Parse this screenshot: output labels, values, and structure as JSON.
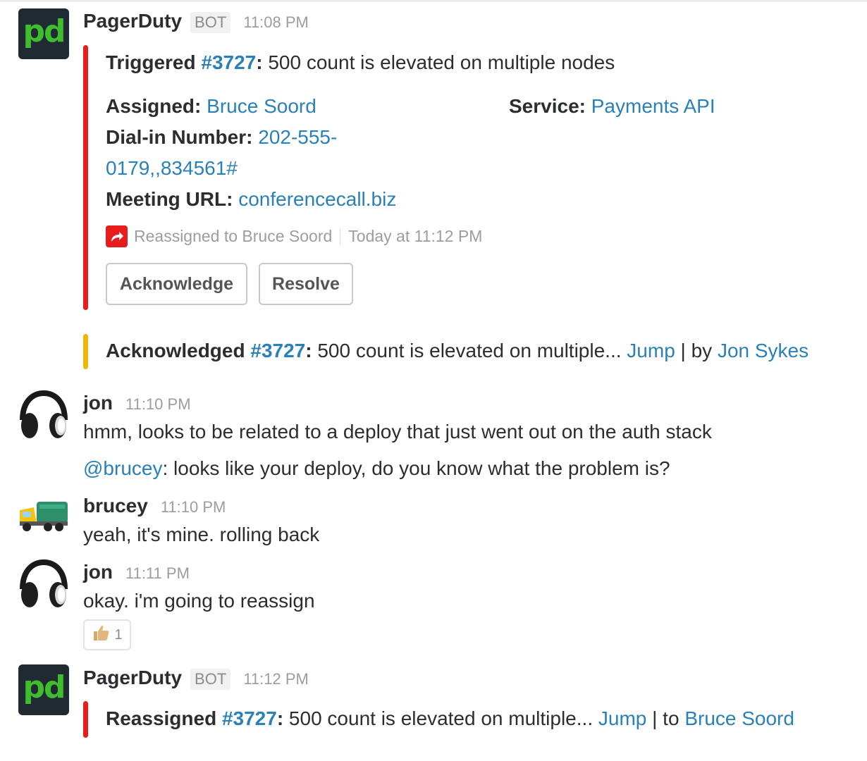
{
  "messages": [
    {
      "user": "PagerDuty",
      "badge": "BOT",
      "time": "11:08 PM",
      "avatar_text": "pd",
      "attachment": {
        "status": "Triggered",
        "incident": "#3727",
        "colon": ":",
        "summary": " 500 count is elevated on multiple nodes",
        "fields": {
          "assigned_label": "Assigned:",
          "assigned_value": "Bruce Soord",
          "service_label": "Service:",
          "service_value": "Payments API",
          "dialin_label": "Dial-in Number:",
          "dialin_value_line1": "202-555-",
          "dialin_value_line2": "0179,,834561#",
          "meeting_label": "Meeting URL:",
          "meeting_value": "conferencecall.biz"
        },
        "context": {
          "text": "Reassigned to Bruce Soord",
          "time": "Today at 11:12 PM"
        },
        "buttons": {
          "acknowledge": "Acknowledge",
          "resolve": "Resolve"
        }
      },
      "followup": {
        "status": "Acknowledged",
        "incident": "#3727",
        "colon": ":",
        "summary": " 500 count is elevated on multiple...",
        "jump": "Jump",
        "sep": " | by ",
        "person": "Jon Sykes"
      }
    },
    {
      "user": "jon",
      "time": "11:10 PM",
      "line1": "hmm, looks to be related to a deploy that just went out on the auth stack",
      "mention": "@brucey",
      "line2": ": looks like your deploy, do you know what the problem is?"
    },
    {
      "user": "brucey",
      "time": "11:10 PM",
      "line1": "yeah, it's mine. rolling back"
    },
    {
      "user": "jon",
      "time": "11:11 PM",
      "line1": "okay. i'm going to reassign",
      "reaction": {
        "emoji": "thumbs-up",
        "count": "1"
      }
    },
    {
      "user": "PagerDuty",
      "badge": "BOT",
      "time": "11:12 PM",
      "avatar_text": "pd",
      "attachment": {
        "status": "Reassigned",
        "incident": "#3727",
        "colon": ":",
        "summary": " 500 count is elevated on multiple...",
        "jump": "Jump",
        "sep": " | to ",
        "person": "Bruce Soord"
      }
    }
  ],
  "colors": {
    "pd_green": "#3fbd2e",
    "pd_bg": "#1f2a33",
    "link": "#2a80b9",
    "triggered_bar": "#e81c1c",
    "acknowledged_bar": "#f2b407"
  }
}
